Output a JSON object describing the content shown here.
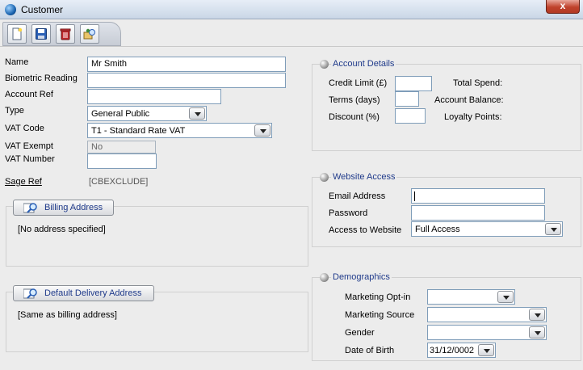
{
  "window": {
    "title": "Customer",
    "close_label": "x"
  },
  "toolbar": {
    "buttons": [
      {
        "name": "new-record",
        "icon": "new-document-icon"
      },
      {
        "name": "save",
        "icon": "save-disk-icon"
      },
      {
        "name": "delete",
        "icon": "trash-icon"
      },
      {
        "name": "lookup",
        "icon": "lookup-icon"
      }
    ]
  },
  "customer": {
    "name_label": "Name",
    "name_value": "Mr Smith",
    "biometric_label": "Biometric Reading",
    "biometric_value": "",
    "account_ref_label": "Account Ref",
    "account_ref_value": "",
    "type_label": "Type",
    "type_value": "General Public",
    "vat_code_label": "VAT Code",
    "vat_code_value": "T1 - Standard Rate VAT",
    "vat_exempt_label": "VAT Exempt",
    "vat_exempt_value": "No",
    "vat_number_label": "VAT Number",
    "vat_number_value": "",
    "sage_ref_label": "Sage Ref",
    "sage_ref_value": "[CBEXCLUDE]"
  },
  "billing": {
    "button_label": "Billing Address",
    "text": "[No address specified]"
  },
  "delivery": {
    "button_label": "Default Delivery Address",
    "text": "[Same as billing address]"
  },
  "account_details": {
    "title": "Account Details",
    "credit_limit_label": "Credit Limit (£)",
    "credit_limit_value": "",
    "terms_label": "Terms (days)",
    "terms_value": "",
    "discount_label": "Discount (%)",
    "discount_value": "",
    "total_spend_label": "Total Spend:",
    "account_balance_label": "Account Balance:",
    "loyalty_points_label": "Loyalty Points:"
  },
  "website_access": {
    "title": "Website Access",
    "email_label": "Email Address",
    "email_value": "",
    "password_label": "Password",
    "password_value": "",
    "access_label": "Access to Website",
    "access_value": "Full Access"
  },
  "demographics": {
    "title": "Demographics",
    "opt_in_label": "Marketing Opt-in",
    "opt_in_value": "",
    "source_label": "Marketing Source",
    "source_value": "",
    "gender_label": "Gender",
    "gender_value": "",
    "dob_label": "Date of Birth",
    "dob_value": "31/12/0002"
  },
  "colors": {
    "group_title": "#1f3a8a",
    "field_border": "#7f9db9",
    "close_button": "#c0422c"
  }
}
